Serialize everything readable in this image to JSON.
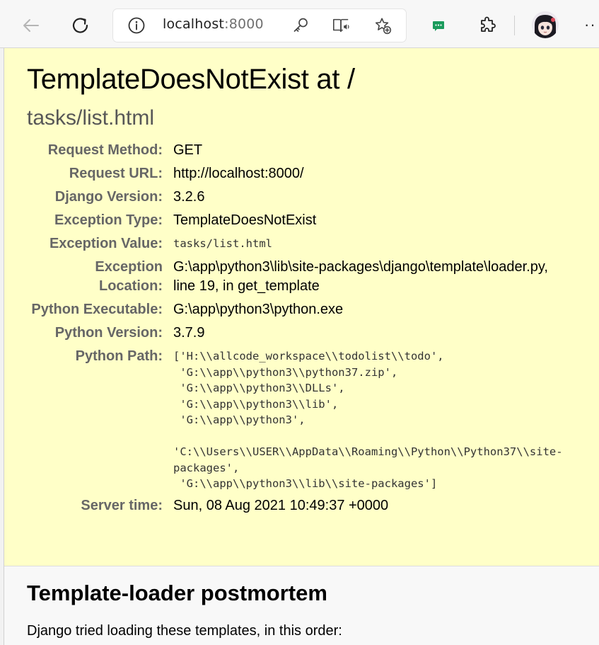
{
  "browser": {
    "address": {
      "host": "localhost",
      "port": ":8000"
    },
    "icons": {
      "back": "back-arrow-icon",
      "reload": "reload-icon",
      "info": "info-icon",
      "key": "key-icon",
      "read_aloud": "immersive-reader-icon",
      "favorite": "add-favorite-icon",
      "extension": "extension-badge-icon",
      "extensions": "puzzle-icon",
      "more": "more-icon"
    },
    "accent_color": "#1a9b5c"
  },
  "error": {
    "title": "TemplateDoesNotExist at /",
    "subtitle": "tasks/list.html",
    "meta": [
      {
        "label": "Request Method:",
        "value": "GET",
        "mono": false
      },
      {
        "label": "Request URL:",
        "value": "http://localhost:8000/",
        "mono": false
      },
      {
        "label": "Django Version:",
        "value": "3.2.6",
        "mono": false
      },
      {
        "label": "Exception Type:",
        "value": "TemplateDoesNotExist",
        "mono": false
      },
      {
        "label": "Exception Value:",
        "value": "tasks/list.html",
        "mono": true
      },
      {
        "label": "Exception Location:",
        "value": "G:\\app\\python3\\lib\\site-packages\\django\\template\\loader.py, line 19, in get_template",
        "mono": false
      },
      {
        "label": "Python Executable:",
        "value": "G:\\app\\python3\\python.exe",
        "mono": false
      },
      {
        "label": "Python Version:",
        "value": "3.7.9",
        "mono": false
      }
    ],
    "python_path": {
      "label": "Python Path:",
      "lines": [
        "['H:\\\\allcode_workspace\\\\todolist\\\\todo',",
        " 'G:\\\\app\\\\python3\\\\python37.zip',",
        " 'G:\\\\app\\\\python3\\\\DLLs',",
        " 'G:\\\\app\\\\python3\\\\lib',",
        " 'G:\\\\app\\\\python3',",
        "",
        "'C:\\\\Users\\\\USER\\\\AppData\\\\Roaming\\\\Python\\\\Python37\\\\site-",
        "packages',",
        " 'G:\\\\app\\\\python3\\\\lib\\\\site-packages']"
      ]
    },
    "server_time": {
      "label": "Server time:",
      "value": "Sun, 08 Aug 2021 10:49:37 +0000"
    }
  },
  "postmortem": {
    "heading": "Template-loader postmortem",
    "intro": "Django tried loading these templates, in this order:"
  }
}
